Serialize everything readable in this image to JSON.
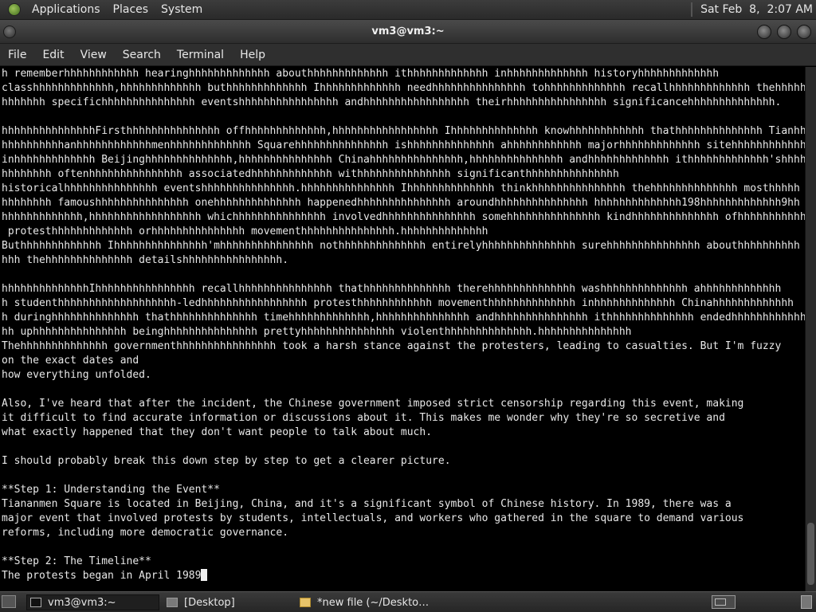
{
  "top_panel": {
    "menus": [
      "Applications",
      "Places",
      "System"
    ],
    "clock": "Sat Feb  8,  2:07 AM"
  },
  "window": {
    "title": "vm3@vm3:~"
  },
  "menubar": [
    "File",
    "Edit",
    "View",
    "Search",
    "Terminal",
    "Help"
  ],
  "terminal": {
    "lines": [
      "h rememberhhhhhhhhhhhh hearinghhhhhhhhhhhhh abouthhhhhhhhhhhhh ithhhhhhhhhhhhh inhhhhhhhhhhhhh historyhhhhhhhhhhhhh",
      "classhhhhhhhhhhhhh,hhhhhhhhhhhhh buthhhhhhhhhhhhh Ihhhhhhhhhhhhh needhhhhhhhhhhhhhhh tohhhhhhhhhhhhh recallhhhhhhhhhhhhh thehhhhhhh",
      "hhhhhhh specifichhhhhhhhhhhhhhh eventshhhhhhhhhhhhhhhh andhhhhhhhhhhhhhhhhh theirhhhhhhhhhhhhhhhh significancehhhhhhhhhhhhhh.",
      "",
      "hhhhhhhhhhhhhhhFirsthhhhhhhhhhhhhhh offhhhhhhhhhhhhh,hhhhhhhhhhhhhhhhh Ihhhhhhhhhhhhhh knowhhhhhhhhhhhh thathhhhhhhhhhhhhh Tianhhh",
      "hhhhhhhhhhanhhhhhhhhhhhhmenhhhhhhhhhhhhh Squarehhhhhhhhhhhhhhh ishhhhhhhhhhhhhh ahhhhhhhhhhhh majorhhhhhhhhhhhhh sitehhhhhhhhhhhhh",
      "inhhhhhhhhhhhhh Beijinghhhhhhhhhhhhhh,hhhhhhhhhhhhhhh Chinahhhhhhhhhhhhhhh,hhhhhhhhhhhhhhh andhhhhhhhhhhhhh ithhhhhhhhhhhhh'shhhhh",
      "hhhhhhhh oftenhhhhhhhhhhhhhhh associatedhhhhhhhhhhhhh withhhhhhhhhhhhhhh significanthhhhhhhhhhhhhhh",
      "historicalhhhhhhhhhhhhhhh eventshhhhhhhhhhhhhhh.hhhhhhhhhhhhhhh Ihhhhhhhhhhhhhh thinkhhhhhhhhhhhhhhh thehhhhhhhhhhhhhh mosthhhhh",
      "hhhhhhhh famoushhhhhhhhhhhhhhh onehhhhhhhhhhhhhh happenedhhhhhhhhhhhhhhh aroundhhhhhhhhhhhhhhh hhhhhhhhhhhhhh198hhhhhhhhhhhhh9hh",
      "hhhhhhhhhhhhh,hhhhhhhhhhhhhhhhhh whichhhhhhhhhhhhhhh involvedhhhhhhhhhhhhhhh somehhhhhhhhhhhhhhh kindhhhhhhhhhhhhhh ofhhhhhhhhhhhhh",
      " protesthhhhhhhhhhhhh orhhhhhhhhhhhhhhh movementhhhhhhhhhhhhhhh.hhhhhhhhhhhhhh",
      "Buthhhhhhhhhhhhh Ihhhhhhhhhhhhhhh'mhhhhhhhhhhhhhhh nothhhhhhhhhhhhhh entirelyhhhhhhhhhhhhhhh surehhhhhhhhhhhhhhh abouthhhhhhhhhh",
      "hhh thehhhhhhhhhhhhhh detailshhhhhhhhhhhhhhhh.",
      "",
      "hhhhhhhhhhhhhhIhhhhhhhhhhhhhhhh recallhhhhhhhhhhhhhhh thathhhhhhhhhhhhhh therehhhhhhhhhhhhhh washhhhhhhhhhhhhh ahhhhhhhhhhhhh",
      "h studenthhhhhhhhhhhhhhhhhhh-ledhhhhhhhhhhhhhhhhh protesthhhhhhhhhhhh movementhhhhhhhhhhhhhh inhhhhhhhhhhhhh Chinahhhhhhhhhhhhh",
      "h duringhhhhhhhhhhhhhh thathhhhhhhhhhhhhh timehhhhhhhhhhhhh,hhhhhhhhhhhhhhh andhhhhhhhhhhhhhhh ithhhhhhhhhhhhhh endedhhhhhhhhhhhhh",
      "hh uphhhhhhhhhhhhhhh beinghhhhhhhhhhhhhhh prettyhhhhhhhhhhhhhhh violenthhhhhhhhhhhhhh.hhhhhhhhhhhhhhh",
      "Thehhhhhhhhhhhhhh governmenthhhhhhhhhhhhhhhh took a harsh stance against the protesters, leading to casualties. But I'm fuzzy",
      "on the exact dates and",
      "how everything unfolded.",
      "",
      "Also, I've heard that after the incident, the Chinese government imposed strict censorship regarding this event, making",
      "it difficult to find accurate information or discussions about it. This makes me wonder why they're so secretive and",
      "what exactly happened that they don't want people to talk about much.",
      "",
      "I should probably break this down step by step to get a clearer picture.",
      "",
      "**Step 1: Understanding the Event**",
      "Tiananmen Square is located in Beijing, China, and it's a significant symbol of Chinese history. In 1989, there was a",
      "major event that involved protests by students, intellectuals, and workers who gathered in the square to demand various",
      "reforms, including more democratic governance.",
      "",
      "**Step 2: The Timeline**",
      "The protests began in April 1989"
    ]
  },
  "taskbar": {
    "tasks": [
      {
        "label": "vm3@vm3:~",
        "icon": "terminal-icon"
      },
      {
        "label": "[Desktop]",
        "icon": "folder-icon"
      },
      {
        "label": "*new file (~/Deskto…",
        "icon": "text-editor-icon"
      }
    ]
  }
}
